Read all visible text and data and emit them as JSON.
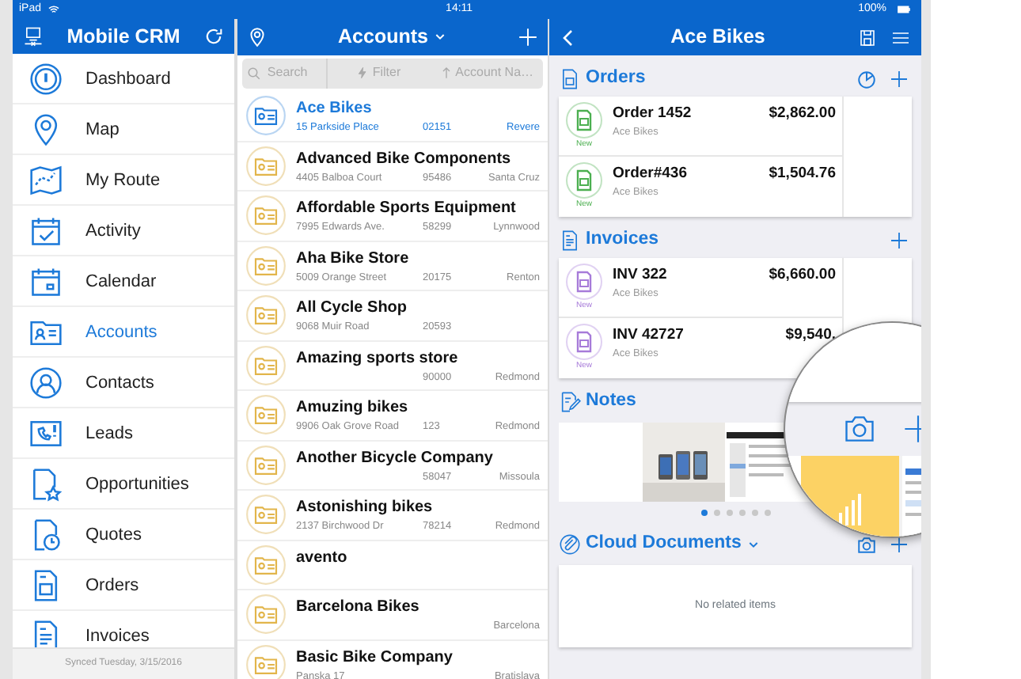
{
  "status_bar": {
    "carrier": "iPad",
    "time": "14:11",
    "battery": "100%"
  },
  "sidebar": {
    "title": "Mobile CRM",
    "items": [
      {
        "label": "Dashboard",
        "selected": false
      },
      {
        "label": "Map",
        "selected": false
      },
      {
        "label": "My Route",
        "selected": false
      },
      {
        "label": "Activity",
        "selected": false
      },
      {
        "label": "Calendar",
        "selected": false
      },
      {
        "label": "Accounts",
        "selected": true
      },
      {
        "label": "Contacts",
        "selected": false
      },
      {
        "label": "Leads",
        "selected": false
      },
      {
        "label": "Opportunities",
        "selected": false
      },
      {
        "label": "Quotes",
        "selected": false
      },
      {
        "label": "Orders",
        "selected": false
      },
      {
        "label": "Invoices",
        "selected": false
      }
    ],
    "footer": "Synced Tuesday, 3/15/2016"
  },
  "list": {
    "title": "Accounts",
    "search": {
      "placeholder": "Search"
    },
    "filter_button": "Filter",
    "sort_button": "Account Na…",
    "accounts": [
      {
        "name": "Ace Bikes",
        "address": "15 Parkside Place",
        "zip": "02151",
        "city": "Revere",
        "selected": true
      },
      {
        "name": "Advanced Bike Components",
        "address": "4405 Balboa Court",
        "zip": "95486",
        "city": "Santa Cruz",
        "selected": false
      },
      {
        "name": "Affordable Sports Equipment",
        "address": "7995 Edwards Ave.",
        "zip": "58299",
        "city": "Lynnwood",
        "selected": false
      },
      {
        "name": "Aha Bike Store",
        "address": "5009 Orange Street",
        "zip": "20175",
        "city": "Renton",
        "selected": false
      },
      {
        "name": "All Cycle Shop",
        "address": "9068 Muir Road",
        "zip": "20593",
        "selected": false
      },
      {
        "name": "Amazing sports store",
        "zip": "90000",
        "city": "Redmond",
        "selected": false
      },
      {
        "name": "Amuzing bikes",
        "address": "9906 Oak Grove Road",
        "zip": "123",
        "city": "Redmond",
        "selected": false
      },
      {
        "name": "Another Bicycle Company",
        "zip": "58047",
        "city": "Missoula",
        "selected": false
      },
      {
        "name": "Astonishing bikes",
        "address": "2137 Birchwood Dr",
        "zip": "78214",
        "city": "Redmond",
        "selected": false
      },
      {
        "name": "avento",
        "selected": false
      },
      {
        "name": "Barcelona Bikes",
        "city": "Barcelona",
        "selected": false
      },
      {
        "name": "Basic Bike Company",
        "address": "Panska 17",
        "city": "Bratislava",
        "selected": false
      }
    ]
  },
  "detail": {
    "title": "Ace Bikes",
    "sections": [
      {
        "kind": "orders",
        "title": "Orders",
        "items": [
          {
            "title": "Order 1452",
            "subtitle": "Ace Bikes",
            "amount": "$2,862.00",
            "status": "New"
          },
          {
            "title": "Order#436",
            "subtitle": "Ace Bikes",
            "amount": "$1,504.76",
            "status": "New"
          }
        ]
      },
      {
        "kind": "invoices",
        "title": "Invoices",
        "items": [
          {
            "title": "INV 322",
            "subtitle": "Ace Bikes",
            "amount": "$6,660.00",
            "status": "New"
          },
          {
            "title": "INV 42727",
            "subtitle": "Ace Bikes",
            "amount": "$9,540.",
            "status": "New"
          }
        ]
      },
      {
        "kind": "notes",
        "title": "Notes",
        "pages": [
          {
            "selected": true
          },
          {
            "selected": false
          },
          {
            "selected": false
          },
          {
            "selected": false
          },
          {
            "selected": false
          },
          {
            "selected": false
          }
        ]
      },
      {
        "kind": "documents",
        "title": "Cloud Documents",
        "empty_text": "No related items"
      }
    ]
  }
}
